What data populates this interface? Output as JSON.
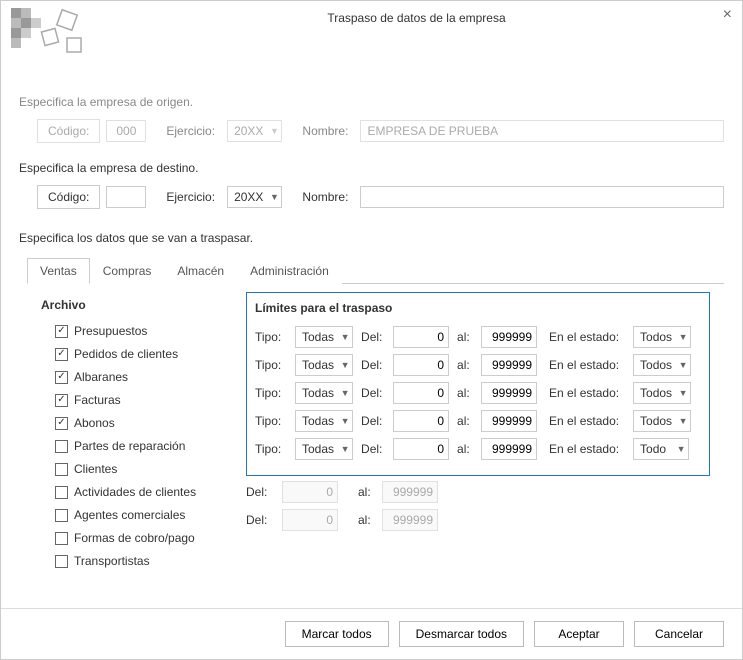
{
  "window": {
    "title": "Traspaso de datos de la empresa",
    "close": "×"
  },
  "origin": {
    "section": "Especifica la empresa de origen.",
    "code_label": "Código:",
    "code_value": "000",
    "year_label": "Ejercicio:",
    "year_value": "20XX",
    "name_label": "Nombre:",
    "name_value": "EMPRESA DE PRUEBA"
  },
  "dest": {
    "section": "Especifica la empresa de destino.",
    "code_label": "Código:",
    "code_value": "",
    "year_label": "Ejercicio:",
    "year_value": "20XX",
    "name_label": "Nombre:",
    "name_value": ""
  },
  "transfer_section": "Especifica los datos que se van a traspasar.",
  "tabs": [
    "Ventas",
    "Compras",
    "Almacén",
    "Administración"
  ],
  "ventas": {
    "archivo_header": "Archivo",
    "limites_header": "Límites para el traspaso",
    "items": [
      {
        "label": "Presupuestos",
        "checked": true,
        "limits": true
      },
      {
        "label": "Pedidos de clientes",
        "checked": true,
        "limits": true
      },
      {
        "label": "Albaranes",
        "checked": true,
        "limits": true
      },
      {
        "label": "Facturas",
        "checked": true,
        "limits": true
      },
      {
        "label": "Abonos",
        "checked": true,
        "limits": true,
        "estado": "Todo"
      },
      {
        "label": "Partes de reparación",
        "checked": false,
        "simple": true
      },
      {
        "label": "Clientes",
        "checked": false,
        "simple": true
      },
      {
        "label": "Actividades de clientes",
        "checked": false
      },
      {
        "label": "Agentes comerciales",
        "checked": false
      },
      {
        "label": "Formas de cobro/pago",
        "checked": false
      },
      {
        "label": "Transportistas",
        "checked": false
      }
    ],
    "labels": {
      "tipo": "Tipo:",
      "todas": "Todas",
      "del": "Del:",
      "al": "al:",
      "estado": "En el estado:",
      "todos": "Todos",
      "from": "0",
      "to": "999999"
    }
  },
  "footer": {
    "mark_all": "Marcar todos",
    "unmark_all": "Desmarcar todos",
    "accept": "Aceptar",
    "cancel": "Cancelar"
  }
}
